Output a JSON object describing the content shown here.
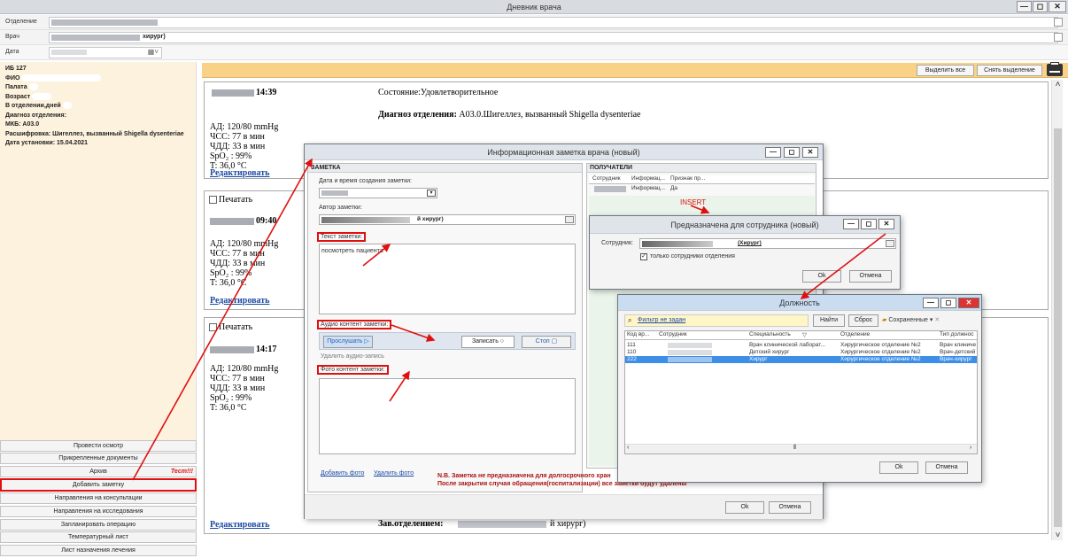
{
  "window": {
    "title": "Дневник врача",
    "min": "—",
    "max": "◻",
    "close": "✕"
  },
  "filters": {
    "dept_label": "Отделение",
    "doctor_label": "Врач",
    "doctor_value": "хирург)",
    "date_label": "Дата"
  },
  "patient": {
    "ib": "ИБ 127",
    "fio": "ФИО",
    "ward": "Палата",
    "age": "Возраст",
    "days": "В отделении,дней",
    "dept_diag": "Диагноз отделения:",
    "mkb": "МКБ: A03.0",
    "decode": "Расшифровка: Шигеллез, вызванный Shigella dysenteriae",
    "date_set": "Дата установки: 15.04.2021"
  },
  "left_buttons": [
    "Провести осмотр",
    "Прикрепленные документы",
    "Архив",
    "Добавить заметку",
    "Направления на консультации",
    "Направления на исследования",
    "Запланировать операцию",
    "Температурный лист",
    "Лист назначения лечения"
  ],
  "archive_tag": "Тест!!!",
  "toolbar": {
    "select_all": "Выделить все",
    "deselect": "Снять выделение"
  },
  "entries": [
    {
      "time": "14:39",
      "state": "Состояние:Удовлетворительное",
      "diag_label": "Диагноз отделения:",
      "diag_text": "A03.0.Шигеллез, вызванный Shigella dysenteriae",
      "ad": "АД: 120/80 mmHg",
      "chss": "ЧСС: 77 в мин",
      "chdd": "ЧДД: 33 в мин",
      "spo": "SpO₂ : 99%",
      "t": "T: 36,0 °C",
      "edit": "Редактировать"
    },
    {
      "print": "Печатать",
      "time": "09:40",
      "ad": "АД: 120/80 mmHg",
      "chss": "ЧСС: 77 в мин",
      "chdd": "ЧДД: 33 в мин",
      "spo": "SpO₂ : 99%",
      "t": "T: 36,0 °C",
      "edit": "Редактировать"
    },
    {
      "print": "Печатать",
      "time": "14:17",
      "ad": "АД: 120/80 mmHg",
      "chss": "ЧСС: 77 в мин",
      "chdd": "ЧДД: 33 в мин",
      "spo": "SpO₂ : 99%",
      "t": "T: 36,0 °C",
      "edit": "Редактировать",
      "head": "Зав.отделением:",
      "head_tail": "й хирург)"
    }
  ],
  "note_dialog": {
    "title": "Информационная заметка врача (новый)",
    "section": "ЗАМЕТКА",
    "recipients": "ПОЛУЧАТЕЛИ",
    "date_label": "Дата и время создания заметки:",
    "author_label": "Автор заметки:",
    "author_value": "й хирург)",
    "text_label": "Текст заметки:",
    "text_value": "посмотреть пациента",
    "audio_label": "Аудио контент заметки:",
    "listen": "Прослушать",
    "record": "Записать",
    "stop": "Стоп",
    "delete_audio": "Удалить аудио-запись",
    "photo_label": "Фото контент заметки:",
    "add_photo": "Добавить фото",
    "delete_photo": "Удалить фото",
    "rec_cols": [
      "Сотрудник",
      "Информац...",
      "Признак пр..."
    ],
    "rec_row": [
      "Информац...",
      "Да"
    ],
    "warn1": "N.B. Заметка не предназначена для долгосрочного хран",
    "warn2": "После закрытия случая обращения(госпитализации) все заметки будут удалены",
    "ok": "Ok",
    "cancel": "Отмена"
  },
  "insert_label": "INSERT",
  "emp_dialog": {
    "title": "Предназначена для сотрудника (новый)",
    "emp_label": "Сотрудник:",
    "emp_value": "(Хирург)",
    "only_dept": "только сотрудники отделения",
    "ok": "Ok",
    "cancel": "Отмена"
  },
  "pos_dialog": {
    "title": "Должность",
    "filter": "Фильтр не задан",
    "find": "Найти",
    "reset": "Сброс",
    "saved": "Сохраненные",
    "cols": [
      "Код вр...",
      "Сотрудник",
      "Специальность",
      "Отделение",
      "Тип должнос"
    ],
    "rows": [
      [
        "111",
        "",
        "Врач клинической лаборат...",
        "Хирургическое отделение №2",
        "Врач клиниче"
      ],
      [
        "110",
        "",
        "Детский хирург",
        "Хирургическое отделение №2",
        "Врач-детский"
      ],
      [
        "222",
        "",
        "Хирург",
        "Хирургическое отделение №2",
        "Врач-хирург"
      ]
    ],
    "ok": "Ok",
    "cancel": "Отмена"
  },
  "colors": {
    "accent_orange": "#fad287",
    "left_panel": "#fdf2dd",
    "annotation_red": "#e01010",
    "selection_blue": "#3d8ee6"
  }
}
